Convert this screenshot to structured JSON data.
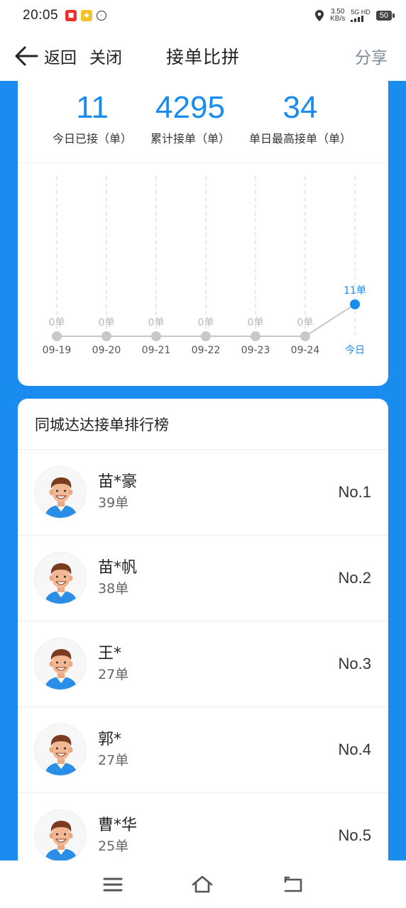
{
  "status": {
    "time": "20:05",
    "speed_value": "3.50",
    "speed_unit": "KB/s",
    "network": "5G HD",
    "battery": "50"
  },
  "nav": {
    "back_label": "返回",
    "close_label": "关闭",
    "title": "接单比拼",
    "share_label": "分享"
  },
  "stats": [
    {
      "value": "11",
      "label": "今日已接（单）"
    },
    {
      "value": "4295",
      "label": "累计接单（单）"
    },
    {
      "value": "34",
      "label": "单日最高接单（单）"
    }
  ],
  "chart_data": {
    "type": "line",
    "categories": [
      "09-19",
      "09-20",
      "09-21",
      "09-22",
      "09-23",
      "09-24",
      "今日"
    ],
    "values": [
      0,
      0,
      0,
      0,
      0,
      0,
      11
    ],
    "data_labels": [
      "0单",
      "0单",
      "0单",
      "0单",
      "0单",
      "0单",
      "11单"
    ],
    "highlight_index": 6,
    "colors": {
      "normal": "#c8c8c8",
      "highlight": "#1a8cf0"
    }
  },
  "ranking": {
    "title": "同城达达接单排行榜",
    "items": [
      {
        "name": "苗*豪",
        "count": "39单",
        "rank": "No.1"
      },
      {
        "name": "苗*帆",
        "count": "38单",
        "rank": "No.2"
      },
      {
        "name": "王*",
        "count": "27单",
        "rank": "No.3"
      },
      {
        "name": "郭*",
        "count": "27单",
        "rank": "No.4"
      },
      {
        "name": "曹*华",
        "count": "25单",
        "rank": "No.5"
      }
    ]
  },
  "colors": {
    "accent": "#1a8cf0"
  }
}
